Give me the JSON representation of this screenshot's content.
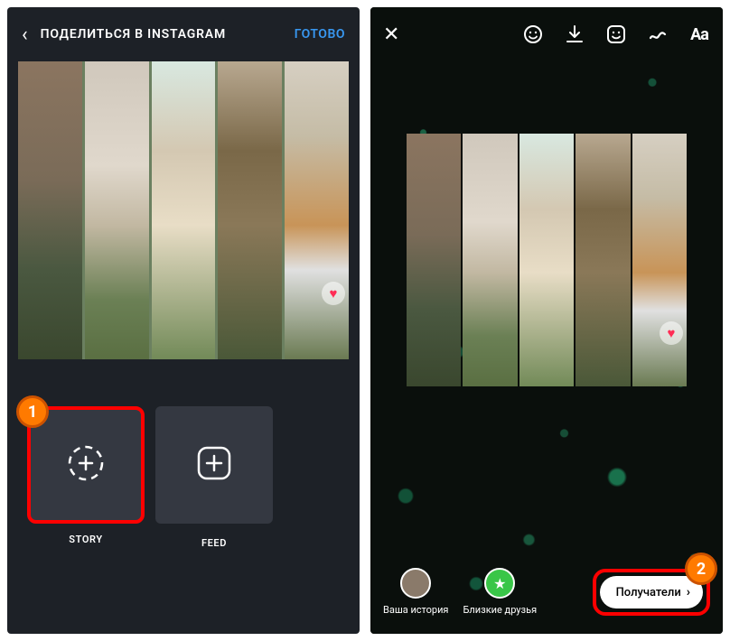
{
  "left": {
    "header_title": "ПОДЕЛИТЬСЯ В INSTAGRAM",
    "done": "ГОТОВО",
    "story_label": "STORY",
    "feed_label": "FEED"
  },
  "right": {
    "aa": "Aa",
    "your_story": "Ваша история",
    "close_friends": "Близкие друзья",
    "recipients": "Получатели"
  },
  "badges": {
    "one": "1",
    "two": "2"
  }
}
